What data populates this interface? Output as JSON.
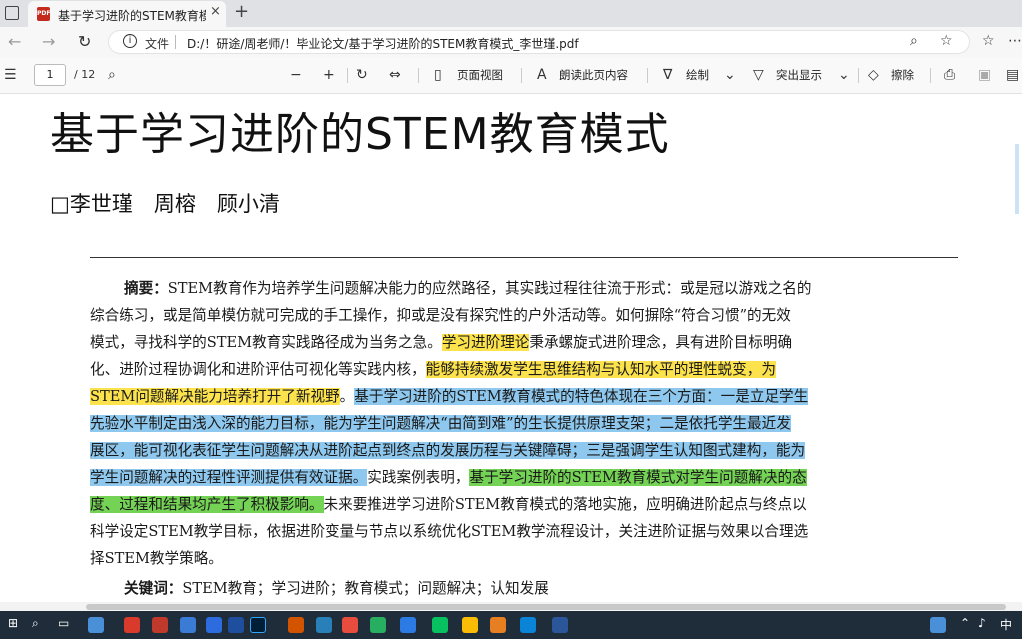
{
  "browser": {
    "tab_title": "基于学习进阶的STEM教育模式_李世瑾",
    "close_glyph": "×",
    "new_tab_glyph": "+",
    "address_label": "文件",
    "url": "D:/！研途/周老师/！毕业论文/基于学习进阶的STEM教育模式_李世瑾.pdf"
  },
  "pdf_toolbar": {
    "page_current": "1",
    "page_total": "/ 12",
    "page_view": "页面视图",
    "read_aloud": "朗读此页内容",
    "draw": "绘制",
    "highlight": "突出显示",
    "erase": "擦除"
  },
  "document": {
    "title": "基于学习进阶的STEM教育模式",
    "authors": "□李世瑾　周榕　顾小清",
    "abstract_label": "摘要：",
    "lines": {
      "l1": "STEM教育作为培养学生问题解决能力的应然路径，其实践过程往往流于形式：或是冠以游戏之名的",
      "l2": "综合练习，或是简单模仿就可完成的手工操作，抑或是没有探究性的户外活动等。如何摒除“符合习惯”的无效",
      "l3a": "模式，寻找科学的STEM教育实践路径成为当务之急。",
      "l3b": "学习进阶理论",
      "l3c": "秉承螺旋式进阶理念，具有进阶目标明确",
      "l4a": "化、进阶过程协调化和进阶评估可视化等实践内核，",
      "l4b": "能够持续激发学生思维结构与认知水平的理性蜕变，为",
      "l5a": "STEM问题解决能力培养打开了新视野",
      "l5b": "。",
      "l5c": "基于学习进阶的STEM教育模式的特色体现在三个方面：一是立足学生",
      "l6": "先验水平制定由浅入深的能力目标，能为学生问题解决“由简到难”的生长提供原理支架；二是依托学生最近发",
      "l7": "展区，能可视化表征学生问题解决从进阶起点到终点的发展历程与关键障碍；三是强调学生认知图式建构，能为",
      "l8a": "学生问题解决的过程性评测提供有效证据。",
      "l8b": "实践案例表明，",
      "l8c": "基于学习进阶的STEM教育模式对学生问题解决的态",
      "l9a": "度、过程和结果均产生了积极影响。",
      "l9b": "未来要推进学习进阶STEM教育模式的落地实施，应明确进阶起点与终点以",
      "l10": "科学设定STEM教学目标，依据进阶变量与节点以系统优化STEM教学流程设计，关注进阶证据与效果以合理选",
      "l11": "择STEM教学策略。"
    },
    "keywords_label": "关键词：",
    "keywords": "STEM教育；学习进阶；教育模式；问题解决；认知发展"
  },
  "taskbar": {
    "input_method": "中"
  },
  "colors": {
    "highlight_yellow": "#fce34d",
    "highlight_blue": "#8fc8ee",
    "highlight_green": "#74d255",
    "taskbar": "#1f2d3a"
  }
}
